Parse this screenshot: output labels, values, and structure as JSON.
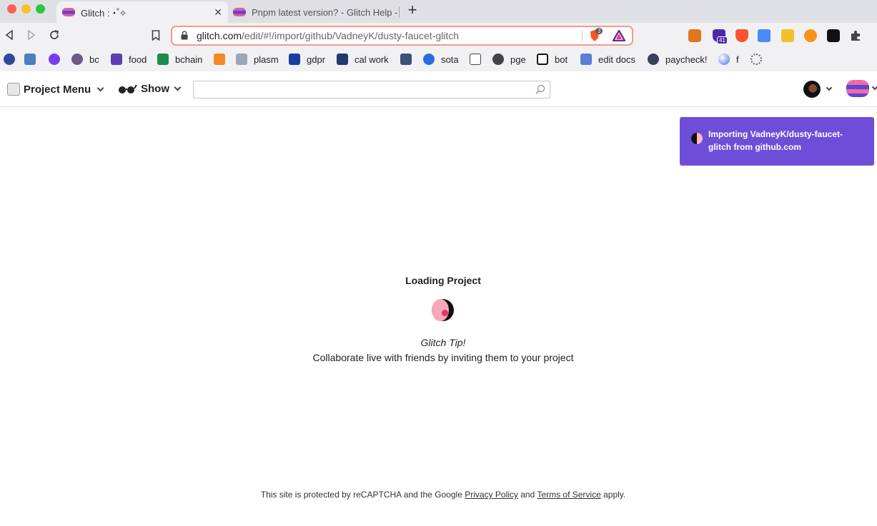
{
  "browser": {
    "tabs": [
      {
        "title": "Glitch :・゚✧",
        "active": true
      },
      {
        "title": "Pnpm latest version? - Glitch Help -",
        "active": false
      }
    ],
    "new_tab_label": "+",
    "close_glyph": "✕",
    "url": {
      "host": "glitch.com",
      "path": "/edit/#!/import/github/VadneyK/dusty-faucet-glitch"
    },
    "shield_count": "3",
    "ext_badge": "41",
    "bookmarks": [
      "bc",
      "food",
      "bchain",
      "plasm",
      "gdpr",
      "cal work",
      "sota",
      "pge",
      "bot",
      "edit docs",
      "paycheck!",
      "f"
    ]
  },
  "app": {
    "project_menu_label": "Project Menu",
    "show_label": "Show",
    "search_placeholder": ""
  },
  "toast": {
    "text": "Importing VadneyK/dusty-faucet-glitch from github.com"
  },
  "loading": {
    "title": "Loading Project",
    "tip_title": "Glitch Tip!",
    "tip_text": "Collaborate live with friends by inviting them to your project"
  },
  "footer": {
    "prefix": "This site is protected by reCAPTCHA and the Google",
    "privacy_label": "Privacy Policy",
    "and": "and",
    "terms_label": "Terms of Service",
    "suffix": "apply."
  },
  "colors": {
    "accent": "#6e4ed8",
    "url_border": "#f39a8c",
    "loader_pink": "#f7a9bb"
  }
}
